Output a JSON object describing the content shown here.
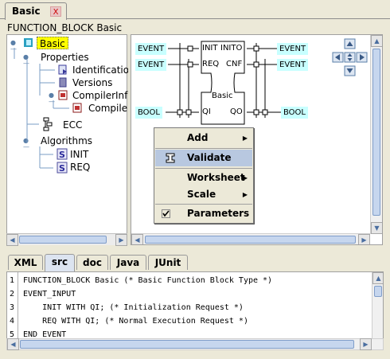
{
  "tab": {
    "title": "Basic",
    "close": "X"
  },
  "fb_title": "FUNCTION_BLOCK Basic",
  "tree": {
    "root": "Basic",
    "properties": "Properties",
    "identification": "Identification",
    "versions": "Versions",
    "compiler_info": "CompilerInfo",
    "compiler": "Compiler",
    "ecc": "ECC",
    "algorithms": "Algorithms",
    "alg_init": "INIT",
    "alg_req": "REQ"
  },
  "diagram": {
    "left_pins": [
      "EVENT",
      "EVENT",
      "BOOL"
    ],
    "right_pins": [
      "EVENT",
      "EVENT",
      "BOOL"
    ],
    "ports_left": [
      "INIT",
      "REQ",
      "QI"
    ],
    "ports_right": [
      "INITO",
      "CNF",
      "QO"
    ],
    "block_name": "Basic"
  },
  "context_menu": {
    "add": "Add",
    "validate": "Validate",
    "worksheet": "Worksheet",
    "scale": "Scale",
    "parameters": "Parameters"
  },
  "bottom_tabs": [
    "XML",
    "src",
    "doc",
    "Java",
    "JUnit"
  ],
  "selected_tab": "src",
  "code": {
    "line_numbers": [
      "1",
      "2",
      "3",
      "4",
      "5"
    ],
    "lines": [
      "FUNCTION_BLOCK Basic (* Basic Function Block Type *)",
      "EVENT_INPUT",
      "    INIT WITH QI; (* Initialization Request *)",
      "    REQ WITH QI; (* Normal Execution Request *)",
      "END_EVENT"
    ]
  },
  "colors": {
    "selection": "#ffff00",
    "pin_fill": "#c8ffff",
    "menu_highlight": "#b8c8e0",
    "window_bg": "#ece9d8"
  }
}
